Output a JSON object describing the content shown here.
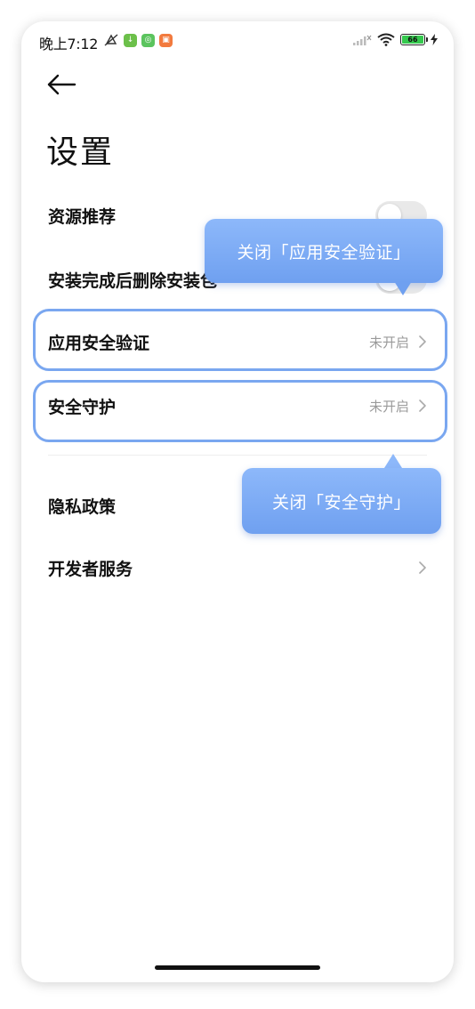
{
  "status_bar": {
    "time": "晚上7:12",
    "battery": "66"
  },
  "header": {
    "title": "设置"
  },
  "settings": {
    "resource_recommend": {
      "label": "资源推荐"
    },
    "delete_after_install": {
      "label": "安装完成后删除安装包"
    },
    "app_security_verify": {
      "label": "应用安全验证",
      "value": "未开启"
    },
    "security_guard": {
      "label": "安全守护",
      "value": "未开启"
    },
    "privacy_policy": {
      "label": "隐私政策"
    },
    "developer_services": {
      "label": "开发者服务"
    }
  },
  "tooltips": {
    "close_app_verify": "关闭「应用安全验证」",
    "close_security_guard": "关闭「安全守护」"
  },
  "colors": {
    "accent": "#7aa7f0",
    "tooltip": "#7fadf6",
    "battery": "#35c94e"
  }
}
